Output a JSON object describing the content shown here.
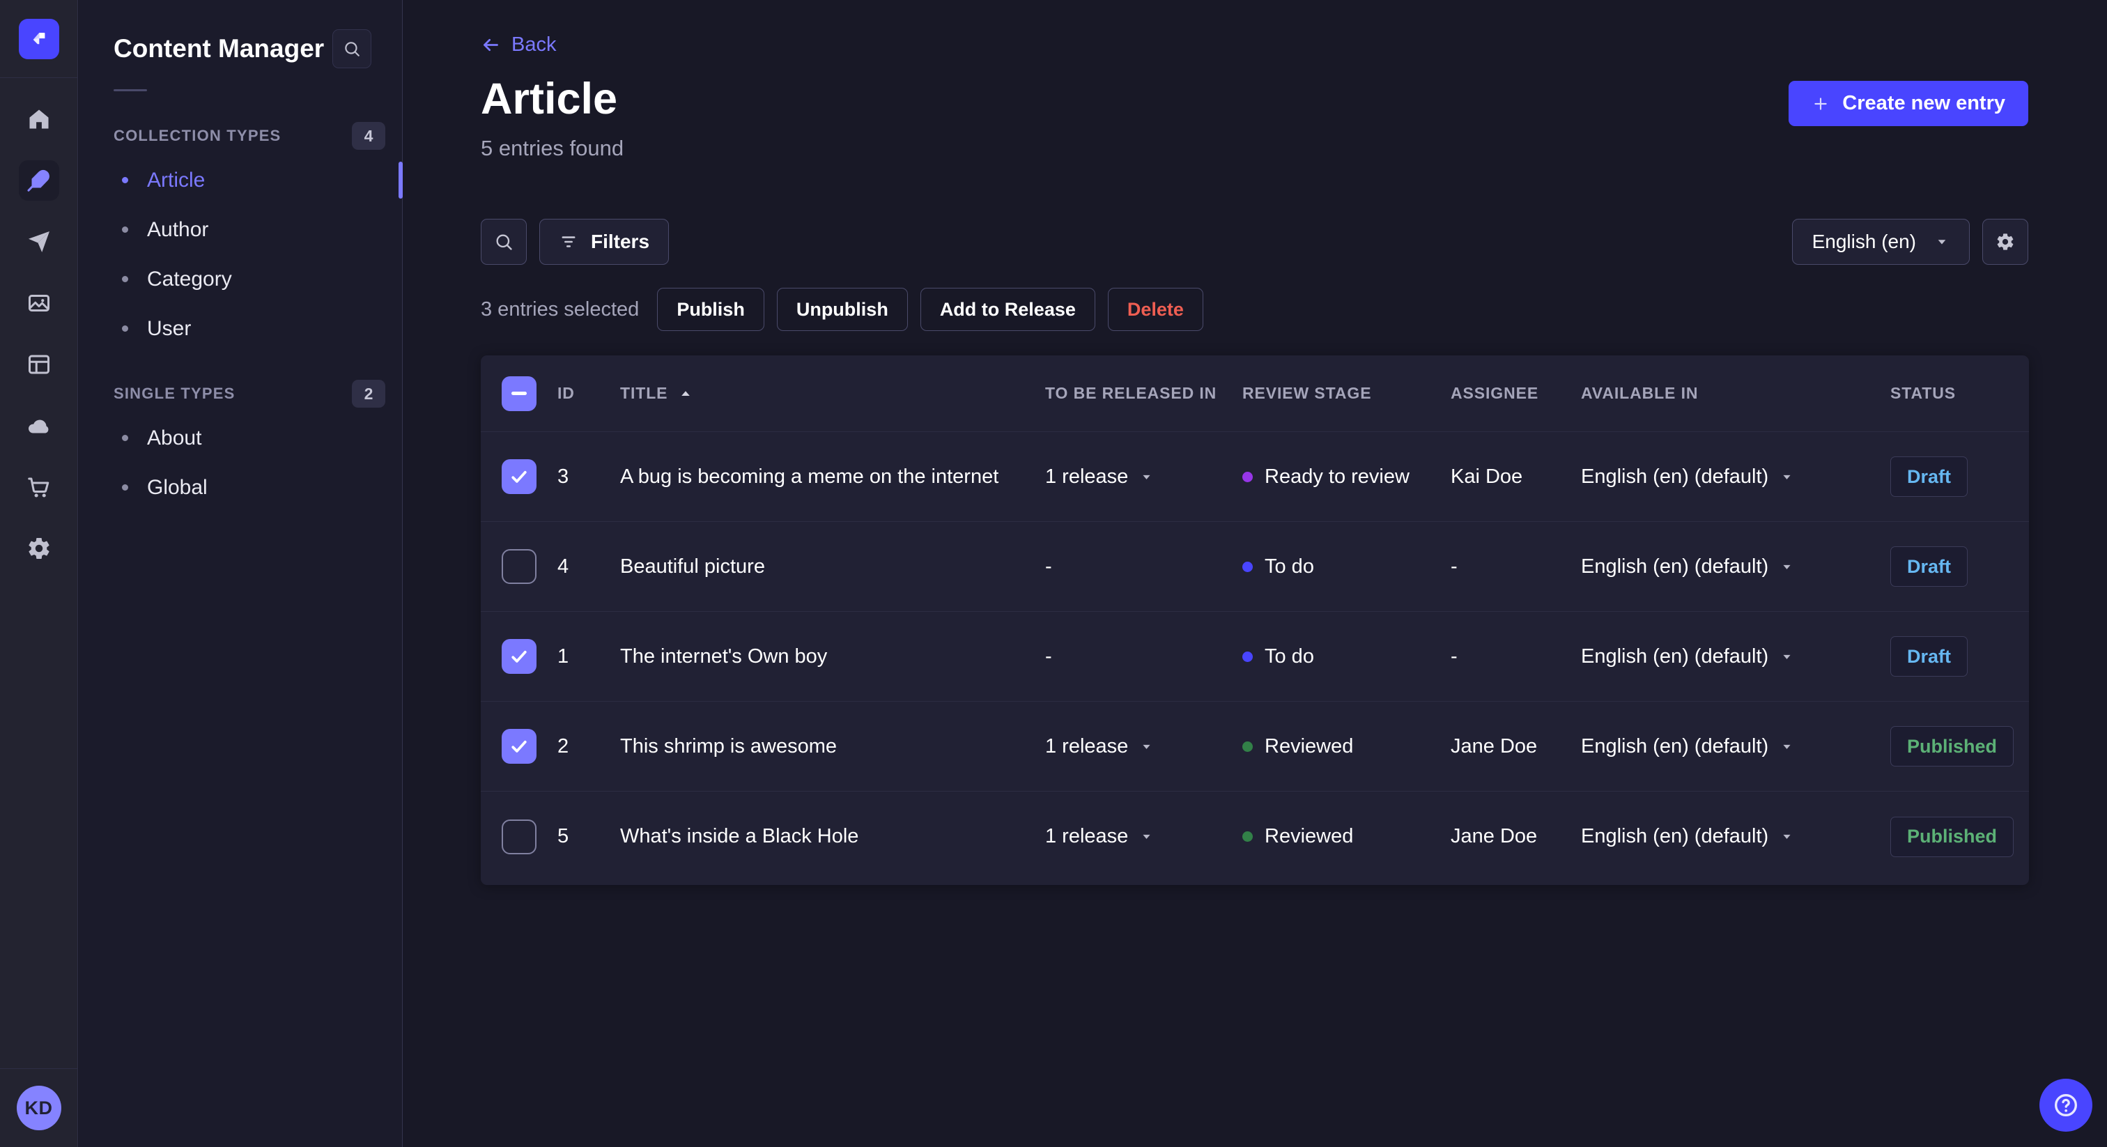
{
  "colors": {
    "primary": "#4945ff",
    "link": "#7b79ff",
    "checkbox": "#7b79ff",
    "danger": "#ee5e52",
    "draft_text": "#66b7f1",
    "published_text": "#5cb176",
    "stage_ready_to_review": "#9736e8",
    "stage_to_do": "#4945ff",
    "stage_reviewed": "#328048",
    "background": "#181826",
    "surface": "#212134",
    "text_muted": "#a5a5ba"
  },
  "rail": {
    "avatar_initials": "KD",
    "items": [
      {
        "name": "home-icon",
        "icon": "home",
        "active": false
      },
      {
        "name": "content-manager-icon",
        "icon": "feather",
        "active": true
      },
      {
        "name": "release-plane-icon",
        "icon": "plane",
        "active": false
      },
      {
        "name": "media-library-icon",
        "icon": "images",
        "active": false
      },
      {
        "name": "content-type-builder-icon",
        "icon": "layout",
        "active": false
      },
      {
        "name": "cloud-icon",
        "icon": "cloud",
        "active": false
      },
      {
        "name": "marketplace-cart-icon",
        "icon": "cart",
        "active": false
      },
      {
        "name": "settings-gear-icon",
        "icon": "gear",
        "active": false
      }
    ]
  },
  "sidebar": {
    "title": "Content Manager",
    "sections": [
      {
        "label": "COLLECTION TYPES",
        "badge": "4",
        "items": [
          {
            "label": "Article",
            "active": true
          },
          {
            "label": "Author",
            "active": false
          },
          {
            "label": "Category",
            "active": false
          },
          {
            "label": "User",
            "active": false
          }
        ]
      },
      {
        "label": "SINGLE TYPES",
        "badge": "2",
        "items": [
          {
            "label": "About",
            "active": false
          },
          {
            "label": "Global",
            "active": false
          }
        ]
      }
    ]
  },
  "header": {
    "back_label": "Back",
    "title": "Article",
    "subtitle": "5 entries found",
    "create_button": "Create new entry"
  },
  "toolbar": {
    "filters_label": "Filters",
    "locale": "English (en)"
  },
  "selection": {
    "text": "3 entries selected",
    "actions": [
      "Publish",
      "Unpublish",
      "Add to Release"
    ],
    "delete_label": "Delete"
  },
  "table": {
    "columns": [
      "ID",
      "TITLE",
      "TO BE RELEASED IN",
      "REVIEW STAGE",
      "ASSIGNEE",
      "AVAILABLE IN",
      "STATUS"
    ],
    "select_all_state": "indeterminate",
    "sort_column": "TITLE",
    "sort_direction": "ascending",
    "rows": [
      {
        "checked": true,
        "id": "3",
        "title": "A bug is becoming a meme on the internet",
        "release": "1 release",
        "release_menu": true,
        "stage": "Ready to review",
        "stage_color": "#9736e8",
        "assignee": "Kai Doe",
        "locale": "English (en) (default)",
        "status": "Draft",
        "status_color": "#66b7f1"
      },
      {
        "checked": false,
        "id": "4",
        "title": "Beautiful picture",
        "release": "-",
        "release_menu": false,
        "stage": "To do",
        "stage_color": "#4945ff",
        "assignee": "-",
        "locale": "English (en) (default)",
        "status": "Draft",
        "status_color": "#66b7f1"
      },
      {
        "checked": true,
        "id": "1",
        "title": "The internet's Own boy",
        "release": "-",
        "release_menu": false,
        "stage": "To do",
        "stage_color": "#4945ff",
        "assignee": "-",
        "locale": "English (en) (default)",
        "status": "Draft",
        "status_color": "#66b7f1"
      },
      {
        "checked": true,
        "id": "2",
        "title": "This shrimp is awesome",
        "release": "1 release",
        "release_menu": true,
        "stage": "Reviewed",
        "stage_color": "#328048",
        "assignee": "Jane Doe",
        "locale": "English (en) (default)",
        "status": "Published",
        "status_color": "#5cb176"
      },
      {
        "checked": false,
        "id": "5",
        "title": "What's inside a Black Hole",
        "release": "1 release",
        "release_menu": true,
        "stage": "Reviewed",
        "stage_color": "#328048",
        "assignee": "Jane Doe",
        "locale": "English (en) (default)",
        "status": "Published",
        "status_color": "#5cb176"
      }
    ]
  }
}
